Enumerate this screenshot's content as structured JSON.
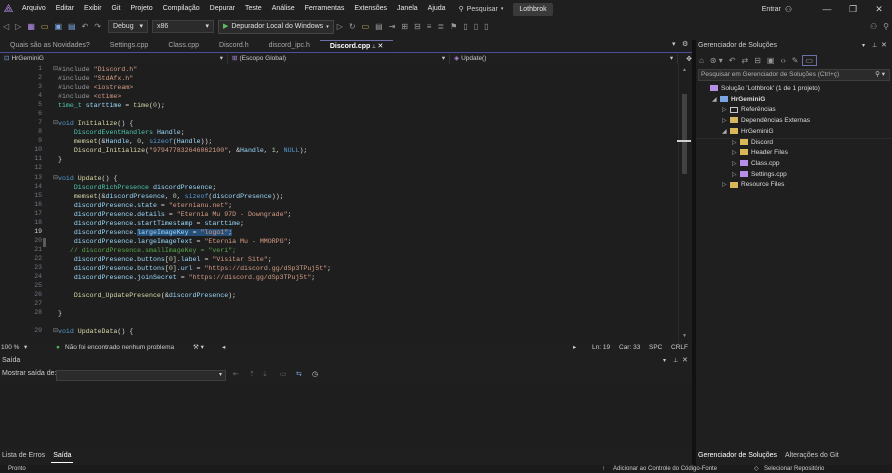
{
  "menu": {
    "items": [
      "Arquivo",
      "Editar",
      "Exibir",
      "Git",
      "Projeto",
      "Compilação",
      "Depurar",
      "Teste",
      "Análise",
      "Ferramentas",
      "Extensões",
      "Janela",
      "Ajuda"
    ],
    "search_label": "Pesquisar",
    "solution_badge": "Lothbrok",
    "enter_label": "Entrar"
  },
  "toolbar": {
    "config": "Debug",
    "platform": "x86",
    "run_label": "Depurador Local do Windows"
  },
  "tabs": [
    {
      "label": "Quais são as Novidades?",
      "active": false
    },
    {
      "label": "Settings.cpp",
      "active": false
    },
    {
      "label": "Class.cpp",
      "active": false
    },
    {
      "label": "Discord.h",
      "active": false
    },
    {
      "label": "discord_ipc.h",
      "active": false
    },
    {
      "label": "Discord.cpp",
      "active": true
    }
  ],
  "navbar": {
    "project": "HrGeminiG",
    "scope": "(Escopo Global)",
    "member": "Update()"
  },
  "editor": {
    "line_numbers": [
      "1",
      "2",
      "3",
      "4",
      "5",
      "6",
      "7",
      "8",
      "9",
      "10",
      "11",
      "12",
      "13",
      "14",
      "15",
      "16",
      "17",
      "18",
      "19",
      "20",
      "21",
      "22",
      "23",
      "24",
      "25",
      "26",
      "27",
      "28",
      "29"
    ],
    "current_line": "19"
  },
  "edstatus": {
    "zoom": "100 %",
    "issues": "Não foi encontrado nenhum problema",
    "ln": "Ln: 19",
    "car": "Car: 33",
    "spc": "SPC",
    "crlf": "CRLF"
  },
  "output": {
    "title": "Saída",
    "show_from_label": "Mostrar saída de:"
  },
  "bottom_tabs": [
    "Lista de Erros",
    "Saída"
  ],
  "solution_explorer": {
    "title": "Gerenciador de Soluções",
    "search_placeholder": "Pesquisar em Gerenciador de Soluções (Ctrl+ç)",
    "items": [
      {
        "label": "Solução 'Lothbrok' (1 de 1 projeto)",
        "indent": 0,
        "arrow": "",
        "kind": "solution"
      },
      {
        "label": "HrGeminiG",
        "indent": 1,
        "arrow": "◢",
        "kind": "project"
      },
      {
        "label": "Referências",
        "indent": 2,
        "arrow": "▷",
        "kind": "refs"
      },
      {
        "label": "Dependências Externas",
        "indent": 2,
        "arrow": "▷",
        "kind": "folder"
      },
      {
        "label": "HrGeminiG",
        "indent": 2,
        "arrow": "◢",
        "kind": "folder"
      },
      {
        "label": "Discord",
        "indent": 3,
        "arrow": "▷",
        "kind": "folder"
      },
      {
        "label": "Header Files",
        "indent": 3,
        "arrow": "▷",
        "kind": "folder"
      },
      {
        "label": "Class.cpp",
        "indent": 3,
        "arrow": "▷",
        "kind": "cpp"
      },
      {
        "label": "Settings.cpp",
        "indent": 3,
        "arrow": "▷",
        "kind": "cpp"
      },
      {
        "label": "Resource Files",
        "indent": 2,
        "arrow": "▷",
        "kind": "folder"
      }
    ],
    "tabs": [
      "Gerenciador de Soluções",
      "Alterações do Git"
    ]
  },
  "statusbar": {
    "left": "Pronto",
    "right1": "Adicionar ao Controle do Código-Fonte",
    "right2": "Selecionar Repositório"
  },
  "colors": {
    "accent": "#6e6ea8",
    "keyword": "#569cd6",
    "string": "#d69d85",
    "comment": "#57a64a"
  }
}
